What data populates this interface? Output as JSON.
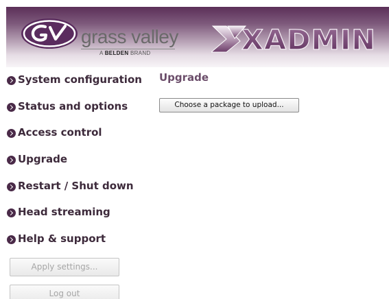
{
  "header": {
    "brand_name": "grass valley",
    "brand_tagline_prefix": "A",
    "brand_tagline_bold": "BELDEN",
    "brand_tagline_suffix": "BRAND",
    "product_logo_text": "XADMIN"
  },
  "sidebar": {
    "items": [
      {
        "label": "System configuration",
        "icon": "chevron-right-circle-icon"
      },
      {
        "label": "Status and options",
        "icon": "chevron-right-circle-icon"
      },
      {
        "label": "Access control",
        "icon": "chevron-right-circle-icon"
      },
      {
        "label": "Upgrade",
        "icon": "chevron-right-circle-icon"
      },
      {
        "label": "Restart / Shut down",
        "icon": "chevron-right-circle-icon"
      },
      {
        "label": "Head streaming",
        "icon": "chevron-right-circle-icon"
      },
      {
        "label": "Help & support",
        "icon": "chevron-right-circle-icon"
      }
    ],
    "apply_button": "Apply settings...",
    "logout_button": "Log out"
  },
  "main": {
    "title": "Upgrade",
    "upload_button": "Choose a package to upload..."
  },
  "colors": {
    "banner_top": "#5b2f58",
    "nav_text": "#3d2a3b",
    "title_text": "#6b4d6a",
    "gv_logo": "#5a2c5e",
    "xadmin_text": "#7a4a78"
  }
}
